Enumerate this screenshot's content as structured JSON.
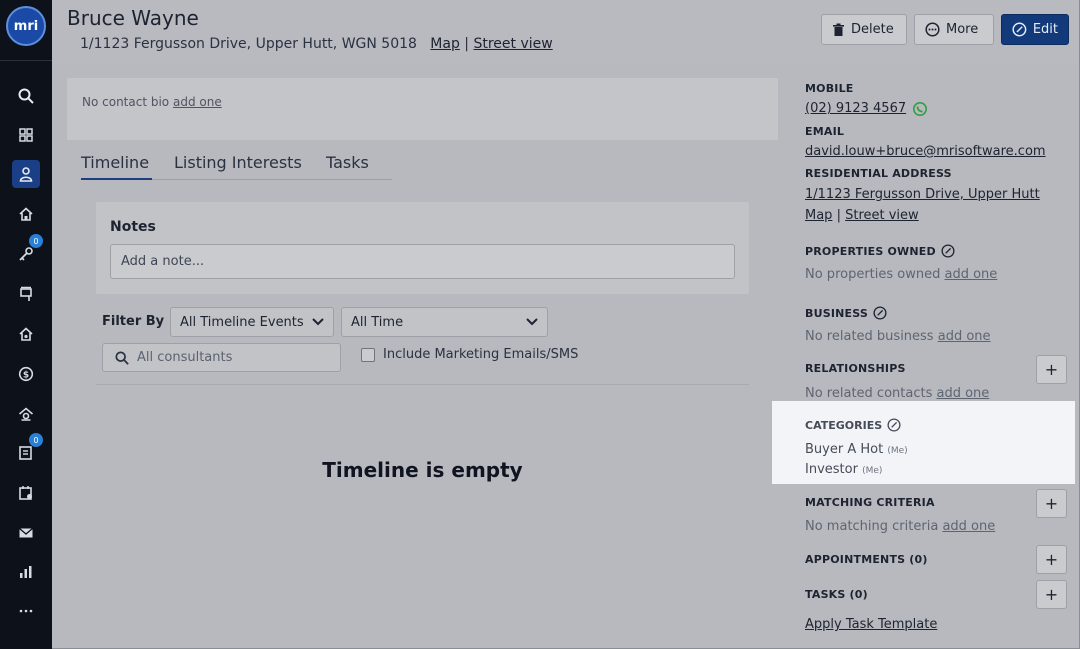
{
  "sidebar": {
    "logo_text": "mri",
    "nav": [
      {
        "name": "search",
        "icon": "search-icon"
      },
      {
        "name": "dashboard",
        "icon": "grid-icon"
      },
      {
        "name": "contacts",
        "icon": "person-icon",
        "active": true
      },
      {
        "name": "properties",
        "icon": "house-icon"
      },
      {
        "name": "prospecting",
        "icon": "key-icon",
        "badge": "0"
      },
      {
        "name": "listings",
        "icon": "sign-icon"
      },
      {
        "name": "sales",
        "icon": "home-heart-icon"
      },
      {
        "name": "finance",
        "icon": "dollar-icon"
      },
      {
        "name": "rentals",
        "icon": "home-gear-icon"
      },
      {
        "name": "tasks",
        "icon": "checklist-icon",
        "badge": "0"
      },
      {
        "name": "calendar",
        "icon": "calendar-icon"
      },
      {
        "name": "mail",
        "icon": "mail-icon"
      },
      {
        "name": "reports",
        "icon": "chart-icon"
      },
      {
        "name": "more",
        "icon": "ellipsis-icon"
      }
    ]
  },
  "header": {
    "name": "Bruce Wayne",
    "address": "1/1123 Fergusson Drive, Upper Hutt, WGN 5018",
    "map_link": "Map",
    "separator": "|",
    "street_view_link": "Street view",
    "delete_label": "Delete",
    "more_label": "More",
    "edit_label": "Edit"
  },
  "bio": {
    "text": "No contact bio",
    "add_link": "add one"
  },
  "tabs": [
    "Timeline",
    "Listing Interests",
    "Tasks"
  ],
  "notes": {
    "title": "Notes",
    "placeholder": "Add a note..."
  },
  "filter": {
    "label": "Filter By",
    "events_value": "All Timeline Events",
    "time_value": "All Time",
    "consultants_placeholder": "All consultants",
    "include_marketing_label": "Include Marketing Emails/SMS"
  },
  "timeline": {
    "empty_text": "Timeline is empty"
  },
  "right_panel": {
    "mobile_label": "MOBILE",
    "mobile_value": "(02) 9123 4567",
    "email_label": "EMAIL",
    "email_value": "david.louw+bruce@mrisoftware.com",
    "residential_label": "RESIDENTIAL ADDRESS",
    "residential_value": "1/1123 Fergusson Drive, Upper Hutt",
    "map_link": "Map",
    "separator": "|",
    "street_view_link": "Street view",
    "properties_label": "PROPERTIES OWNED",
    "properties_empty": "No properties owned",
    "business_label": "BUSINESS",
    "business_empty": "No related business",
    "relationships_label": "RELATIONSHIPS",
    "relationships_empty": "No related contacts",
    "categories_label": "CATEGORIES",
    "categories": [
      {
        "name": "Buyer A Hot",
        "owner": "(Me)"
      },
      {
        "name": "Investor",
        "owner": "(Me)"
      }
    ],
    "matching_label": "MATCHING CRITERIA",
    "matching_empty": "No matching criteria",
    "appointments_label": "APPOINTMENTS (0)",
    "tasks_label": "TASKS (0)",
    "apply_template_link": "Apply Task Template",
    "add_one": "add one",
    "plus": "+"
  }
}
